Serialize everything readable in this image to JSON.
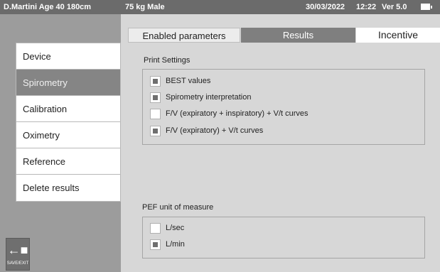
{
  "status_bar": {
    "patient": "D.Martini  Age 40  180cm",
    "weight_sex": "75 kg  Male",
    "date": "30/03/2022",
    "time": "12:22",
    "version": "Ver 5.0"
  },
  "tabs": [
    {
      "label": "Enabled parameters",
      "state": "normal"
    },
    {
      "label": "Results",
      "state": "selected"
    },
    {
      "label": "Incentive",
      "state": "normal"
    }
  ],
  "sidebar": {
    "items": [
      {
        "label": "Device"
      },
      {
        "label": "Spirometry",
        "active": true
      },
      {
        "label": "Calibration"
      },
      {
        "label": "Oximetry"
      },
      {
        "label": "Reference"
      },
      {
        "label": "Delete results"
      }
    ],
    "save_exit_label": "SAVE/EXIT"
  },
  "print_settings": {
    "title": "Print Settings",
    "options": [
      {
        "label": "BEST values",
        "checked": true
      },
      {
        "label": "Spirometry interpretation",
        "checked": true
      },
      {
        "label": "F/V (expiratory + inspiratory) + V/t curves",
        "checked": false
      },
      {
        "label": "F/V (expiratory) + V/t curves",
        "checked": true
      }
    ]
  },
  "pef_unit": {
    "title": "PEF unit of measure",
    "options": [
      {
        "label": "L/sec",
        "checked": false
      },
      {
        "label": "L/min",
        "checked": true
      }
    ]
  },
  "colors": {
    "status_bar": "#6b6b6b",
    "left_panel": "#9c9c9c",
    "content_bg": "#d7d7d7",
    "active_item": "#858585"
  }
}
